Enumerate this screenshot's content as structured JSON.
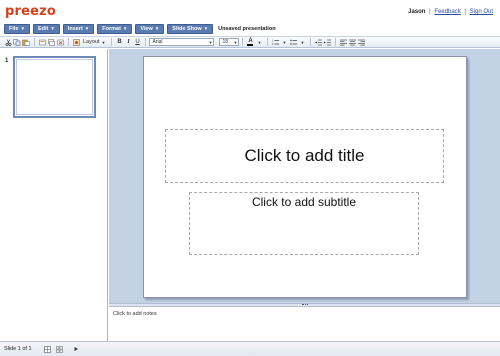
{
  "brand": {
    "logo": "preezo"
  },
  "user": {
    "name": "Jason",
    "separator": "|",
    "feedback": "Feedback",
    "sign_out": "Sign Out"
  },
  "menus": [
    {
      "label": "File"
    },
    {
      "label": "Edit"
    },
    {
      "label": "Insert"
    },
    {
      "label": "Format"
    },
    {
      "label": "View"
    },
    {
      "label": "Slide Show"
    }
  ],
  "document": {
    "title": "Unsaved presentation"
  },
  "toolbar": {
    "layout_label": "Layout",
    "bold": "B",
    "italic": "I",
    "underline": "U",
    "font_value": "Arial",
    "size_value": "18",
    "font_color_glyph": "A"
  },
  "slides": [
    {
      "number": "1"
    }
  ],
  "slide": {
    "title_placeholder": "Click to add title",
    "subtitle_placeholder": "Click to add subtitle"
  },
  "notes": {
    "placeholder": "Click to add notes"
  },
  "status": {
    "text": "Slide 1 of 1"
  },
  "colors": {
    "logo": "#d6411c",
    "menu": "#5a7bb0",
    "workspace": "#c4d2e6",
    "link": "#2a4fa0"
  },
  "icons": [
    "cut-icon",
    "copy-icon",
    "paste-icon",
    "new-slide-icon",
    "duplicate-slide-icon",
    "delete-slide-icon",
    "background-icon",
    "font-color-icon",
    "numbered-list-icon",
    "bullet-list-icon",
    "decrease-indent-icon",
    "increase-indent-icon",
    "align-left-icon",
    "align-center-icon",
    "align-right-icon",
    "slide-sorter-icon",
    "grid-view-icon",
    "play-icon"
  ]
}
